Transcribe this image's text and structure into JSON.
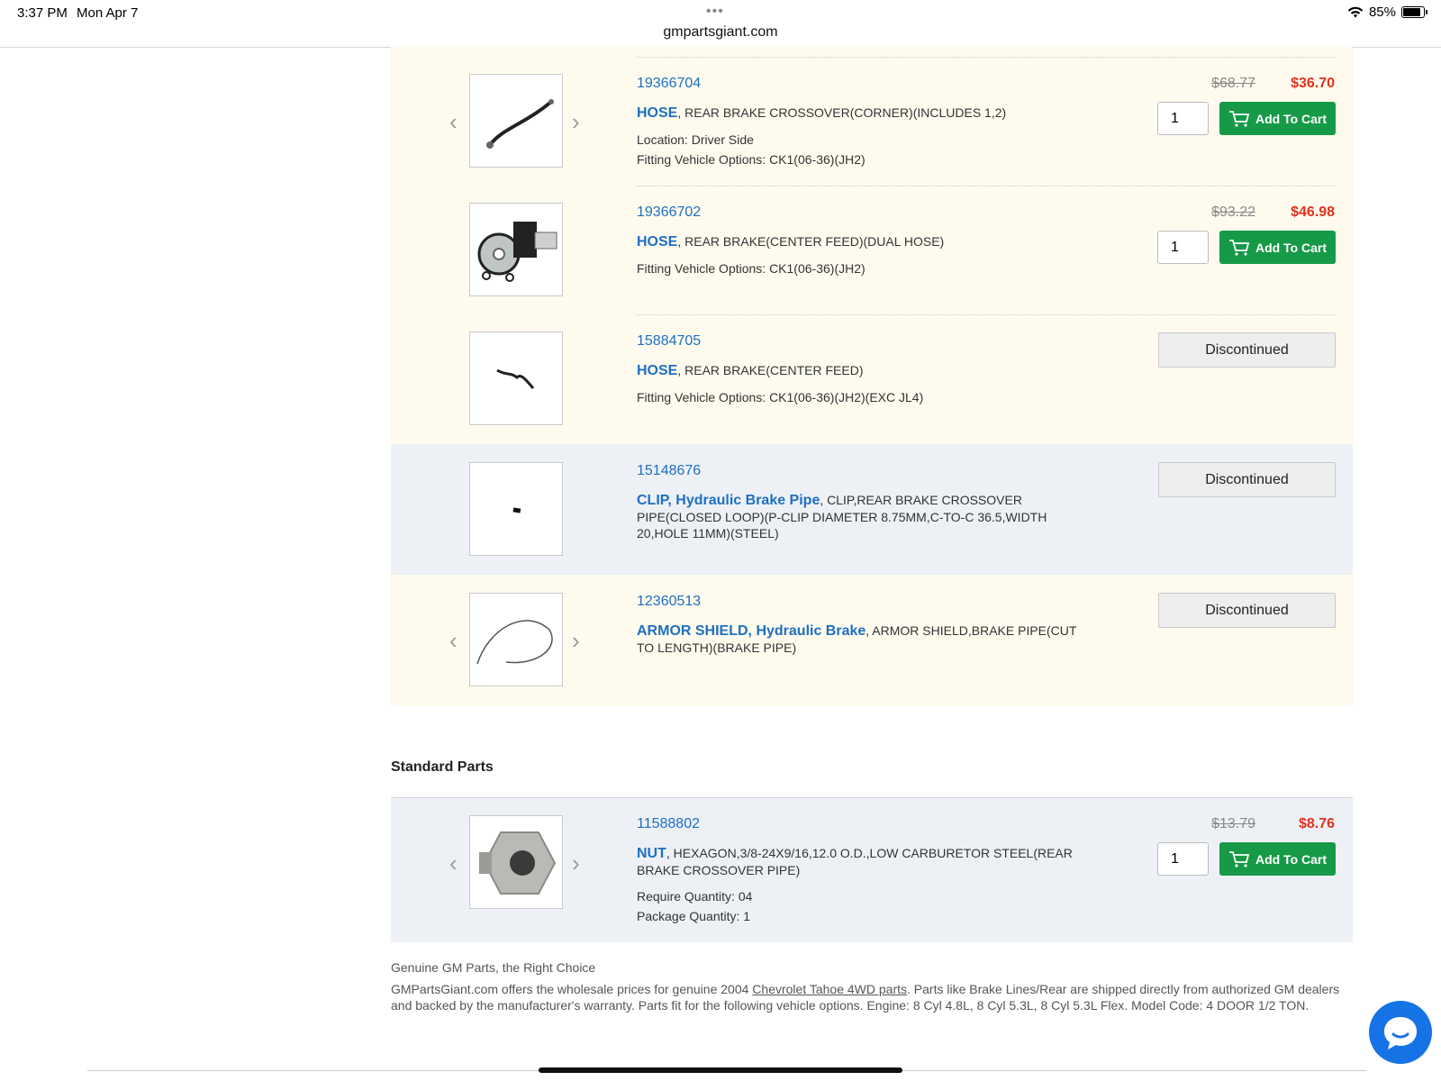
{
  "status_bar": {
    "time": "3:37 PM",
    "date": "Mon Apr 7",
    "url": "gmpartsgiant.com",
    "battery": "85%"
  },
  "parts": [
    {
      "part_number": "19366704",
      "name": "HOSE",
      "description": ", REAR BRAKE CROSSOVER(CORNER)(INCLUDES 1,2)",
      "details": [
        "Location: Driver Side",
        "Fitting Vehicle Options: CK1(06-36)(JH2)"
      ],
      "old_price": "$68.77",
      "price": "$36.70",
      "quantity": "1",
      "action": "Add To Cart"
    },
    {
      "part_number": "19366702",
      "name": "HOSE",
      "description": ", REAR BRAKE(CENTER FEED)(DUAL HOSE)",
      "details": [
        "Fitting Vehicle Options: CK1(06-36)(JH2)"
      ],
      "old_price": "$93.22",
      "price": "$46.98",
      "quantity": "1",
      "action": "Add To Cart"
    },
    {
      "part_number": "15884705",
      "name": "HOSE",
      "description": ", REAR BRAKE(CENTER FEED)",
      "details": [
        "Fitting Vehicle Options: CK1(06-36)(JH2)(EXC JL4)"
      ],
      "action": "Discontinued"
    },
    {
      "part_number": "15148676",
      "name": "CLIP, Hydraulic Brake Pipe",
      "description": ", CLIP,REAR BRAKE CROSSOVER PIPE(CLOSED LOOP)(P-CLIP DIAMETER 8.75MM,C-TO-C 36.5,WIDTH 20,HOLE 11MM)(STEEL)",
      "action": "Discontinued"
    },
    {
      "part_number": "12360513",
      "name": "ARMOR SHIELD, Hydraulic Brake",
      "description": ", ARMOR SHIELD,BRAKE PIPE(CUT TO LENGTH)(BRAKE PIPE)",
      "action": "Discontinued"
    }
  ],
  "standard_parts": {
    "title": "Standard Parts",
    "items": [
      {
        "part_number": "11588802",
        "name": "NUT",
        "description": ", HEXAGON,3/8-24X9/16,12.0 O.D.,LOW CARBURETOR STEEL(REAR BRAKE CROSSOVER PIPE)",
        "details": [
          "Require Quantity: 04",
          "Package Quantity: 1"
        ],
        "old_price": "$13.79",
        "price": "$8.76",
        "quantity": "1",
        "action": "Add To Cart"
      }
    ]
  },
  "footer": {
    "heading": "Genuine GM Parts, the Right Choice",
    "text_before": "GMPartsGiant.com offers the wholesale prices for genuine 2004 ",
    "link": "Chevrolet Tahoe 4WD parts",
    "text_after": ". Parts like Brake Lines/Rear are shipped directly from authorized GM dealers and backed by the manufacturer's warranty. Parts fit for the following vehicle options. Engine: 8 Cyl 4.8L, 8 Cyl 5.3L, 8 Cyl 5.3L Flex. Model Code: 4 DOOR 1/2 TON."
  },
  "colors": {
    "link_blue": "#1f6fc1",
    "sale_red": "#e0321f",
    "cart_green": "#169a47",
    "highlight_row": "#fefbee",
    "gray_row": "#edf1f5"
  }
}
